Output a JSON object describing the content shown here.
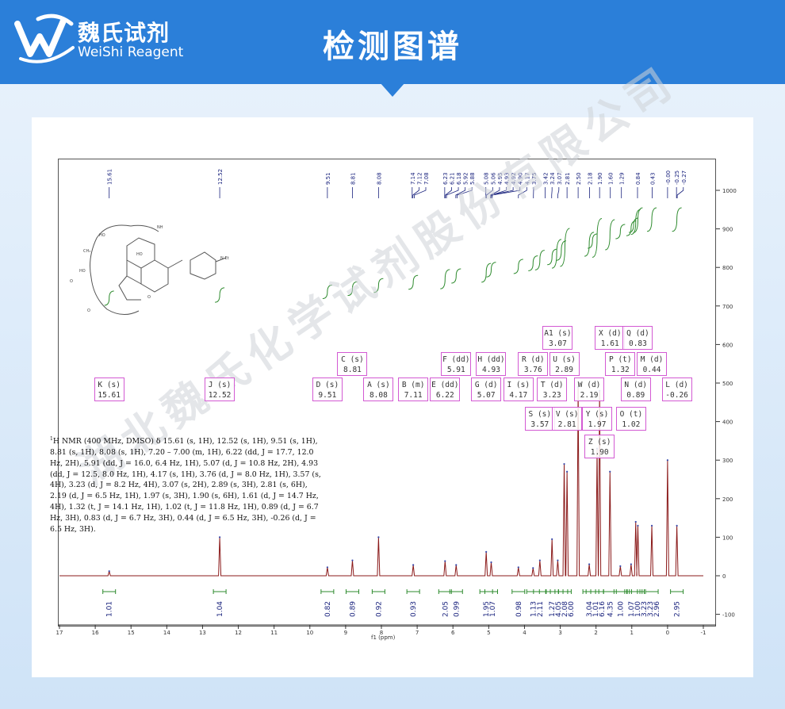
{
  "brand": {
    "cn": "魏氏试剂",
    "en": "WeiShi Reagent"
  },
  "page_title": "检测图谱",
  "watermark": "湖北魏氏化学试剂股份有限公司",
  "nmr_text": {
    "nucleus": "1",
    "body": "H NMR (400 MHz, DMSO) δ 15.61 (s, 1H), 12.52 (s, 1H), 9.51 (s, 1H), 8.81 (s, 1H), 8.08 (s, 1H), 7.20 – 7.00 (m, 1H), 6.22 (dd, J = 17.7, 12.0 Hz, 2H), 5.91 (dd, J = 16.0, 6.4 Hz, 1H), 5.07 (d, J = 10.8 Hz, 2H), 4.93 (dd, J = 12.5, 8.0 Hz, 1H), 4.17 (s, 1H), 3.76 (d, J = 8.0 Hz, 1H), 3.57 (s, 4H), 3.23 (d, J = 8.2 Hz, 4H), 3.07 (s, 2H), 2.89 (s, 3H), 2.81 (s, 6H), 2.19 (d, J = 6.5 Hz, 1H), 1.97 (s, 3H), 1.90 (s, 6H), 1.61 (d, J = 14.7 Hz, 4H), 1.32 (t, J = 14.1 Hz, 1H), 1.02 (t, J = 11.8 Hz, 1H), 0.89 (d, J = 6.7 Hz, 3H), 0.83 (d, J = 6.7 Hz, 3H), 0.44 (d, J = 6.5 Hz, 3H), -0.26 (d, J = 6.5 Hz, 3H)."
  },
  "axis_unit": "f1 (ppm)",
  "multiplets": [
    {
      "label": "K (s)",
      "value": "15.61"
    },
    {
      "label": "J (s)",
      "value": "12.52"
    },
    {
      "label": "D (s)",
      "value": "9.51"
    },
    {
      "label": "C (s)",
      "value": "8.81"
    },
    {
      "label": "A (s)",
      "value": "8.08"
    },
    {
      "label": "B (m)",
      "value": "7.11"
    },
    {
      "label": "E (dd)",
      "value": "6.22"
    },
    {
      "label": "F (dd)",
      "value": "5.91"
    },
    {
      "label": "G (d)",
      "value": "5.07"
    },
    {
      "label": "H (dd)",
      "value": "4.93"
    },
    {
      "label": "I (s)",
      "value": "4.17"
    },
    {
      "label": "R (d)",
      "value": "3.76"
    },
    {
      "label": "S (s)",
      "value": "3.57"
    },
    {
      "label": "T (d)",
      "value": "3.23"
    },
    {
      "label": "A1 (s)",
      "value": "3.07"
    },
    {
      "label": "U (s)",
      "value": "2.89"
    },
    {
      "label": "V (s)",
      "value": "2.81"
    },
    {
      "label": "W (d)",
      "value": "2.19"
    },
    {
      "label": "Y (s)",
      "value": "1.97"
    },
    {
      "label": "Z (s)",
      "value": "1.90"
    },
    {
      "label": "X (d)",
      "value": "1.61"
    },
    {
      "label": "P (t)",
      "value": "1.32"
    },
    {
      "label": "O (t)",
      "value": "1.02"
    },
    {
      "label": "N (d)",
      "value": "0.89"
    },
    {
      "label": "Q (d)",
      "value": "0.83"
    },
    {
      "label": "M (d)",
      "value": "0.44"
    },
    {
      "label": "L (d)",
      "value": "-0.26"
    }
  ],
  "colors": {
    "header": "#2b7fd9",
    "spectrum": "#8b1a1a",
    "integral": "#2e8b2e",
    "peak_label": "#1a237e",
    "multiplet_box": "#d35ad3"
  },
  "chart_data": {
    "type": "line",
    "xlabel": "f1 (ppm)",
    "xlim": [
      17,
      -1
    ],
    "x_ticks": [
      17,
      16,
      15,
      14,
      13,
      12,
      11,
      10,
      9,
      8,
      7,
      6,
      5,
      4,
      3,
      2,
      1,
      0,
      -1
    ],
    "ylim": [
      -100,
      1000
    ],
    "y_ticks": [
      1000,
      900,
      800,
      700,
      600,
      500,
      400,
      300,
      200,
      100,
      0,
      -100
    ],
    "peak_labels": [
      "15.61",
      "12.52",
      "9.51",
      "8.81",
      "8.08",
      "7.14",
      "7.12",
      "7.08",
      "6.23",
      "6.21",
      "6.18",
      "5.92",
      "5.88",
      "5.08",
      "5.06",
      "4.95",
      "4.93",
      "4.92",
      "4.90",
      "4.17",
      "3.75",
      "3.42",
      "3.24",
      "3.07",
      "2.81",
      "2.50",
      "2.18",
      "1.90",
      "1.60",
      "1.29",
      "0.84",
      "0.43",
      "-0.00",
      "-0.25",
      "-0.27"
    ],
    "peaks": [
      {
        "ppm": 15.61,
        "h": 12
      },
      {
        "ppm": 12.52,
        "h": 100
      },
      {
        "ppm": 9.51,
        "h": 22
      },
      {
        "ppm": 8.81,
        "h": 40
      },
      {
        "ppm": 8.08,
        "h": 100
      },
      {
        "ppm": 7.11,
        "h": 28
      },
      {
        "ppm": 6.22,
        "h": 38
      },
      {
        "ppm": 5.91,
        "h": 28
      },
      {
        "ppm": 5.07,
        "h": 62
      },
      {
        "ppm": 4.93,
        "h": 35
      },
      {
        "ppm": 4.17,
        "h": 22
      },
      {
        "ppm": 3.76,
        "h": 20
      },
      {
        "ppm": 3.57,
        "h": 40
      },
      {
        "ppm": 3.23,
        "h": 95
      },
      {
        "ppm": 3.07,
        "h": 40
      },
      {
        "ppm": 2.89,
        "h": 290
      },
      {
        "ppm": 2.81,
        "h": 270
      },
      {
        "ppm": 2.5,
        "h": 490
      },
      {
        "ppm": 2.19,
        "h": 30
      },
      {
        "ppm": 1.97,
        "h": 330
      },
      {
        "ppm": 1.9,
        "h": 480
      },
      {
        "ppm": 1.61,
        "h": 270
      },
      {
        "ppm": 1.32,
        "h": 25
      },
      {
        "ppm": 1.02,
        "h": 30
      },
      {
        "ppm": 0.89,
        "h": 140
      },
      {
        "ppm": 0.83,
        "h": 130
      },
      {
        "ppm": 0.44,
        "h": 130
      },
      {
        "ppm": -0.26,
        "h": 130
      },
      {
        "ppm": 0.0,
        "h": 300
      }
    ],
    "integrals": [
      {
        "ppm": 15.61,
        "value": "1.01"
      },
      {
        "ppm": 12.52,
        "value": "1.04"
      },
      {
        "ppm": 9.51,
        "value": "0.82"
      },
      {
        "ppm": 8.81,
        "value": "0.89"
      },
      {
        "ppm": 8.08,
        "value": "0.92"
      },
      {
        "ppm": 7.11,
        "value": "0.93"
      },
      {
        "ppm": 6.22,
        "value": "2.05"
      },
      {
        "ppm": 5.91,
        "value": "0.99"
      },
      {
        "ppm": 5.07,
        "value": "1.95"
      },
      {
        "ppm": 4.93,
        "value": "1.07"
      },
      {
        "ppm": 4.17,
        "value": "0.98"
      },
      {
        "ppm": 3.76,
        "value": "1.13"
      },
      {
        "ppm": 3.57,
        "value": "2.11"
      },
      {
        "ppm": 3.23,
        "value": "1.27"
      },
      {
        "ppm": 3.1,
        "value": "4.05"
      },
      {
        "ppm": 2.97,
        "value": "2.08"
      },
      {
        "ppm": 2.87,
        "value": "6.00"
      },
      {
        "ppm": 2.19,
        "value": "3.04"
      },
      {
        "ppm": 2.1,
        "value": "1.01"
      },
      {
        "ppm": 1.97,
        "value": "6.16"
      },
      {
        "ppm": 1.61,
        "value": "4.35"
      },
      {
        "ppm": 1.32,
        "value": "1.00"
      },
      {
        "ppm": 1.02,
        "value": "1.07"
      },
      {
        "ppm": 0.95,
        "value": "1.00"
      },
      {
        "ppm": 0.89,
        "value": "3.23"
      },
      {
        "ppm": 0.83,
        "value": "3.23"
      },
      {
        "ppm": 0.44,
        "value": "2.96"
      },
      {
        "ppm": -0.26,
        "value": "2.95"
      }
    ]
  }
}
